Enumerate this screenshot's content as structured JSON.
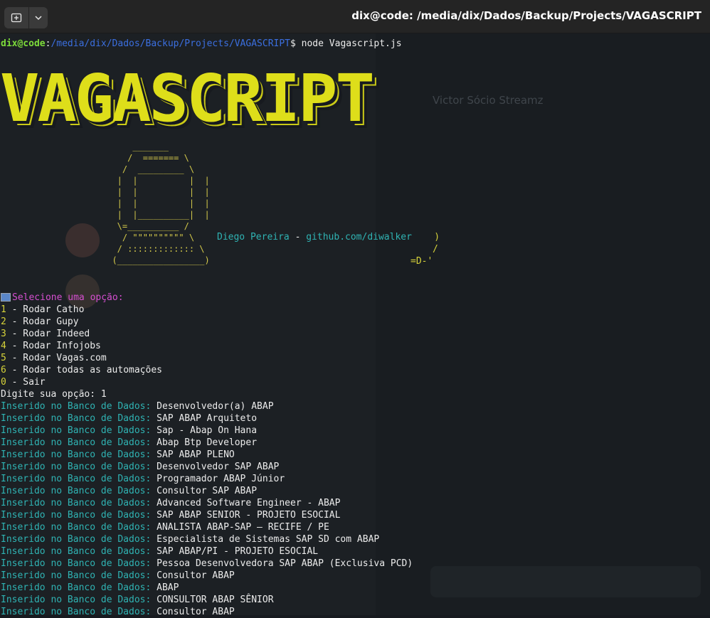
{
  "window": {
    "title": "dix@code: /media/dix/Dados/Backup/Projects/VAGASCRIPT"
  },
  "background_ghost": {
    "chat_title": "Victor Sócio Streamz"
  },
  "prompt": {
    "user_host": "dix@code",
    "separator": ":",
    "path": "/media/dix/Dados/Backup/Projects/VAGASCRIPT",
    "symbol": "$",
    "command": " node Vagascript.js"
  },
  "banner": {
    "text": "VAGASCRIPT"
  },
  "ascii_art": {
    "computer": "      _______\n     /  ======= \\\n    /  _________ \\\n   |  |          |  |\n   |  |          |  |\n   |  |          |  |\n   |  |__________|  |\n   \\=__________ /\n    / \"\"\"\"\"\"\"\"\"\" \\\n   / ::::::::::::: \\\n  (_________________)",
    "author_name": "Diego Pereira",
    "author_sep": " - ",
    "author_link": "github.com/diwalker",
    "speech_close": "    )",
    "speech_slash": "/",
    "face": "=D-'"
  },
  "menu": {
    "prompt_label": "Selecione uma opção:",
    "options": [
      {
        "key": "1",
        "label": " - Rodar Catho"
      },
      {
        "key": "2",
        "label": " - Rodar Gupy"
      },
      {
        "key": "3",
        "label": " - Rodar Indeed"
      },
      {
        "key": "4",
        "label": " - Rodar Infojobs"
      },
      {
        "key": "5",
        "label": " - Rodar Vagas.com"
      },
      {
        "key": "6",
        "label": " - Rodar todas as automações"
      },
      {
        "key": "0",
        "label": " - Sair"
      }
    ],
    "input_line": "Digite sua opção: 1"
  },
  "log": {
    "prefix": "Inserido no Banco de Dados:",
    "entries": [
      "Desenvolvedor(a) ABAP",
      "SAP ABAP Arquiteto",
      "Sap - Abap On Hana",
      "Abap Btp Developer",
      "SAP ABAP PLENO",
      "Desenvolvedor SAP ABAP",
      "Programador ABAP Júnior",
      "Consultor SAP ABAP",
      "Advanced Software Engineer - ABAP",
      "SAP ABAP SENIOR - PROJETO ESOCIAL",
      "ANALISTA ABAP-SAP – RECIFE / PE",
      "Especialista de Sistemas SAP SD com ABAP",
      "SAP ABAP/PI - PROJETO ESOCIAL",
      "Pessoa Desenvolvedora SAP ABAP (Exclusiva PCD)",
      "Consultor ABAP",
      "ABAP",
      "CONSULTOR ABAP SÊNIOR",
      "Consultor ABAP"
    ]
  },
  "colors": {
    "prompt_user": "#7ddc3a",
    "prompt_path": "#3b6fe0",
    "banner": "#dede1a",
    "log_prefix": "#2fb3b3",
    "menu_label": "#d54fd0",
    "option_key": "#d6d23a"
  }
}
